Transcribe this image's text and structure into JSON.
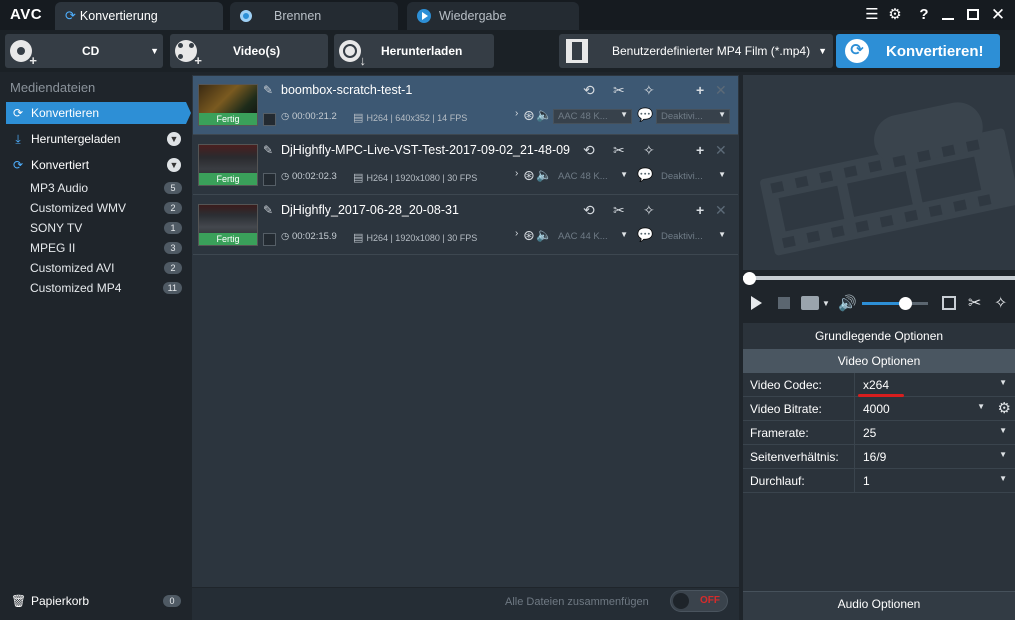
{
  "app": {
    "logo": "AVC"
  },
  "tabs": [
    {
      "label": "Konvertierung",
      "active": true
    },
    {
      "label": "Brennen",
      "active": false
    },
    {
      "label": "Wiedergabe",
      "active": false
    }
  ],
  "window_icons": [
    "list-settings-icon",
    "gear-icon",
    "help-icon",
    "minimize-icon",
    "maximize-icon",
    "close-icon"
  ],
  "window_glyphs": {
    "help": "?"
  },
  "toolbar": {
    "cd_label": "CD",
    "videos_label": "Video(s)",
    "download_label": "Herunterladen",
    "format_label": "Benutzerdefinierter MP4 Film (*.mp4)",
    "convert_label": "Konvertieren!"
  },
  "sidebar": {
    "header": "Mediendateien",
    "items": [
      {
        "label": "Konvertieren",
        "active": true,
        "icon": "refresh-icon"
      },
      {
        "label": "Heruntergeladen",
        "active": false,
        "icon": "download-icon"
      },
      {
        "label": "Konvertiert",
        "active": false,
        "icon": "refresh-icon"
      }
    ],
    "converted": [
      {
        "label": "MP3 Audio",
        "count": "5"
      },
      {
        "label": "Customized WMV",
        "count": "2"
      },
      {
        "label": "SONY TV",
        "count": "1"
      },
      {
        "label": "MPEG II",
        "count": "3"
      },
      {
        "label": "Customized AVI",
        "count": "2"
      },
      {
        "label": "Customized MP4",
        "count": "11"
      }
    ],
    "trash_label": "Papierkorb",
    "trash_count": "0"
  },
  "files": [
    {
      "name": "boombox-scratch-test-1",
      "status": "Fertig",
      "duration": "00:00:21.2",
      "info": "H264 | 640x352 | 14 FPS",
      "audio": "AAC 48 K...",
      "subtitle": "Deaktivi..."
    },
    {
      "name": "DjHighfly-MPC-Live-VST-Test-2017-09-02_21-48-09",
      "status": "Fertig",
      "duration": "00:02:02.3",
      "info": "H264 | 1920x1080 | 30 FPS",
      "audio": "AAC 48 K...",
      "subtitle": "Deaktivi..."
    },
    {
      "name": "DjHighfly_2017-06-28_20-08-31",
      "status": "Fertig",
      "duration": "00:02:15.9",
      "info": "H264 | 1920x1080 | 30 FPS",
      "audio": "AAC 44 K...",
      "subtitle": "Deaktivi..."
    }
  ],
  "merge": {
    "label": "Alle Dateien zusammenfügen",
    "toggle": "OFF"
  },
  "player": {
    "volume": 0.65
  },
  "options": {
    "basic_label": "Grundlegende Optionen",
    "video_label": "Video Optionen",
    "audio_label": "Audio Optionen",
    "rows": [
      {
        "label": "Video Codec:",
        "value": "x264"
      },
      {
        "label": "Video Bitrate:",
        "value": "4000"
      },
      {
        "label": "Framerate:",
        "value": "25"
      },
      {
        "label": "Seitenverhältnis:",
        "value": "16/9"
      },
      {
        "label": "Durchlauf:",
        "value": "1"
      }
    ]
  },
  "colors": {
    "accent": "#2d8fd6",
    "done": "#3aa05a",
    "highlight_underline": "#d81e1e"
  }
}
